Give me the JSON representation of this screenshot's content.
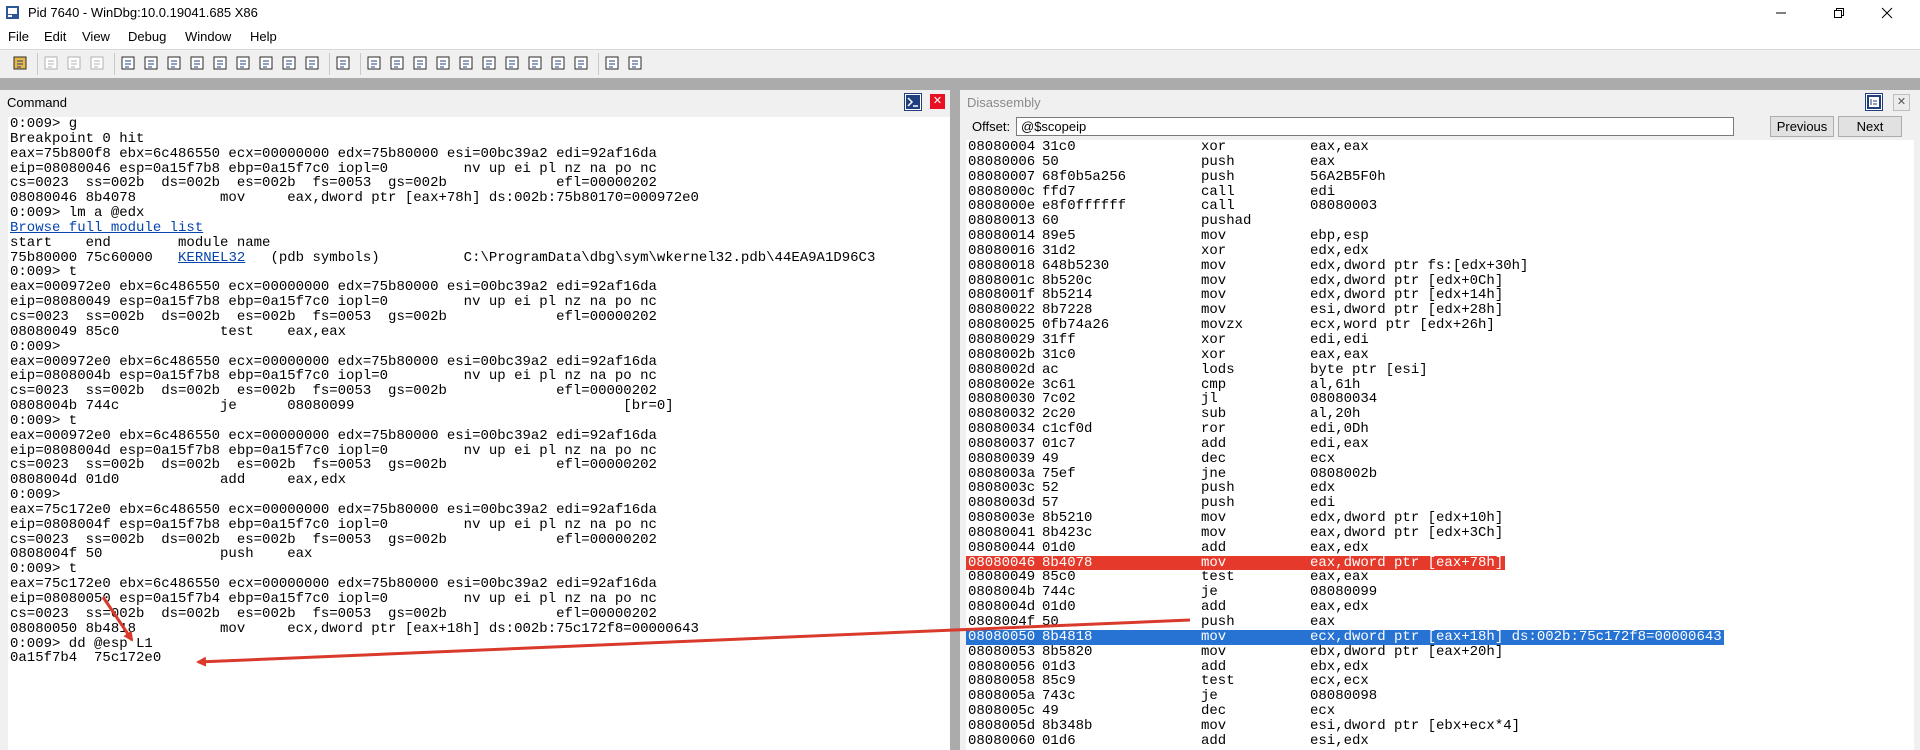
{
  "window": {
    "title": "Pid 7640 - WinDbg:10.0.19041.685 X86"
  },
  "menu": [
    "File",
    "Edit",
    "View",
    "Debug",
    "Window",
    "Help"
  ],
  "toolbar_icons": [
    "open-icon",
    "cut-icon",
    "copy-icon",
    "paste-icon",
    "go-icon",
    "restart-icon",
    "stop-debugging-icon",
    "break-icon",
    "step-into-icon",
    "step-over-icon",
    "step-out-icon",
    "run-to-cursor-icon",
    "source-mode-icon",
    "command-window-icon",
    "watch-window-icon",
    "locals-window-icon",
    "registers-window-icon",
    "memory-window-icon",
    "call-stack-icon",
    "disassembly-window-icon",
    "scratch-pad-icon",
    "processes-threads-icon",
    "source-mode-toggle-icon",
    "hex-mode-icon",
    "font-icon",
    "options-icon"
  ],
  "command": {
    "title": "Command",
    "lines": [
      "0:009> g",
      "Breakpoint 0 hit",
      "eax=75b800f8 ebx=6c486550 ecx=00000000 edx=75b80000 esi=00bc39a2 edi=92af16da",
      "eip=08080046 esp=0a15f7b8 ebp=0a15f7c0 iopl=0         nv up ei pl nz na po nc",
      "cs=0023  ss=002b  ds=002b  es=002b  fs=0053  gs=002b             efl=00000202",
      "08080046 8b4078          mov     eax,dword ptr [eax+78h] ds:002b:75b80170=000972e0",
      "0:009> lm a @edx",
      "Browse full module list",
      "start    end        module name",
      "75b80000 75c60000   KERNEL32   (pdb symbols)          C:\\ProgramData\\dbg\\sym\\wkernel32.pdb\\44EA9A1D96C3",
      "0:009> t",
      "eax=000972e0 ebx=6c486550 ecx=00000000 edx=75b80000 esi=00bc39a2 edi=92af16da",
      "eip=08080049 esp=0a15f7b8 ebp=0a15f7c0 iopl=0         nv up ei pl nz na po nc",
      "cs=0023  ss=002b  ds=002b  es=002b  fs=0053  gs=002b             efl=00000202",
      "08080049 85c0            test    eax,eax",
      "0:009>",
      "eax=000972e0 ebx=6c486550 ecx=00000000 edx=75b80000 esi=00bc39a2 edi=92af16da",
      "eip=0808004b esp=0a15f7b8 ebp=0a15f7c0 iopl=0         nv up ei pl nz na po nc",
      "cs=0023  ss=002b  ds=002b  es=002b  fs=0053  gs=002b             efl=00000202",
      "0808004b 744c            je      08080099                                [br=0]",
      "0:009> t",
      "eax=000972e0 ebx=6c486550 ecx=00000000 edx=75b80000 esi=00bc39a2 edi=92af16da",
      "eip=0808004d esp=0a15f7b8 ebp=0a15f7c0 iopl=0         nv up ei pl nz na po nc",
      "cs=0023  ss=002b  ds=002b  es=002b  fs=0053  gs=002b             efl=00000202",
      "0808004d 01d0            add     eax,edx",
      "0:009>",
      "eax=75c172e0 ebx=6c486550 ecx=00000000 edx=75b80000 esi=00bc39a2 edi=92af16da",
      "eip=0808004f esp=0a15f7b8 ebp=0a15f7c0 iopl=0         nv up ei pl nz na po nc",
      "cs=0023  ss=002b  ds=002b  es=002b  fs=0053  gs=002b             efl=00000202",
      "0808004f 50              push    eax",
      "0:009> t",
      "eax=75c172e0 ebx=6c486550 ecx=00000000 edx=75b80000 esi=00bc39a2 edi=92af16da",
      "eip=08080050 esp=0a15f7b4 ebp=0a15f7c0 iopl=0         nv up ei pl nz na po nc",
      "cs=0023  ss=002b  ds=002b  es=002b  fs=0053  gs=002b             efl=00000202",
      "08080050 8b4818          mov     ecx,dword ptr [eax+18h] ds:002b:75c172f8=00000643",
      "0:009> dd @esp L1",
      "0a15f7b4  75c172e0"
    ],
    "link_line": 7,
    "module_link_text": "KERNEL32"
  },
  "disassembly": {
    "title": "Disassembly",
    "offset_label": "Offset:",
    "offset_value": "@$scopeip",
    "previous_label": "Previous",
    "next_label": "Next",
    "rows": [
      {
        "addr": "08080004",
        "bytes": "31c0",
        "mnem": "xor",
        "ops": "eax,eax"
      },
      {
        "addr": "08080006",
        "bytes": "50",
        "mnem": "push",
        "ops": "eax"
      },
      {
        "addr": "08080007",
        "bytes": "68f0b5a256",
        "mnem": "push",
        "ops": "56A2B5F0h"
      },
      {
        "addr": "0808000c",
        "bytes": "ffd7",
        "mnem": "call",
        "ops": "edi"
      },
      {
        "addr": "0808000e",
        "bytes": "e8f0ffffff",
        "mnem": "call",
        "ops": "08080003"
      },
      {
        "addr": "08080013",
        "bytes": "60",
        "mnem": "pushad",
        "ops": ""
      },
      {
        "addr": "08080014",
        "bytes": "89e5",
        "mnem": "mov",
        "ops": "ebp,esp"
      },
      {
        "addr": "08080016",
        "bytes": "31d2",
        "mnem": "xor",
        "ops": "edx,edx"
      },
      {
        "addr": "08080018",
        "bytes": "648b5230",
        "mnem": "mov",
        "ops": "edx,dword ptr fs:[edx+30h]"
      },
      {
        "addr": "0808001c",
        "bytes": "8b520c",
        "mnem": "mov",
        "ops": "edx,dword ptr [edx+0Ch]"
      },
      {
        "addr": "0808001f",
        "bytes": "8b5214",
        "mnem": "mov",
        "ops": "edx,dword ptr [edx+14h]"
      },
      {
        "addr": "08080022",
        "bytes": "8b7228",
        "mnem": "mov",
        "ops": "esi,dword ptr [edx+28h]"
      },
      {
        "addr": "08080025",
        "bytes": "0fb74a26",
        "mnem": "movzx",
        "ops": "ecx,word ptr [edx+26h]"
      },
      {
        "addr": "08080029",
        "bytes": "31ff",
        "mnem": "xor",
        "ops": "edi,edi"
      },
      {
        "addr": "0808002b",
        "bytes": "31c0",
        "mnem": "xor",
        "ops": "eax,eax"
      },
      {
        "addr": "0808002d",
        "bytes": "ac",
        "mnem": "lods",
        "ops": "byte ptr [esi]"
      },
      {
        "addr": "0808002e",
        "bytes": "3c61",
        "mnem": "cmp",
        "ops": "al,61h"
      },
      {
        "addr": "08080030",
        "bytes": "7c02",
        "mnem": "jl",
        "ops": "08080034"
      },
      {
        "addr": "08080032",
        "bytes": "2c20",
        "mnem": "sub",
        "ops": "al,20h"
      },
      {
        "addr": "08080034",
        "bytes": "c1cf0d",
        "mnem": "ror",
        "ops": "edi,0Dh"
      },
      {
        "addr": "08080037",
        "bytes": "01c7",
        "mnem": "add",
        "ops": "edi,eax"
      },
      {
        "addr": "08080039",
        "bytes": "49",
        "mnem": "dec",
        "ops": "ecx"
      },
      {
        "addr": "0808003a",
        "bytes": "75ef",
        "mnem": "jne",
        "ops": "0808002b"
      },
      {
        "addr": "0808003c",
        "bytes": "52",
        "mnem": "push",
        "ops": "edx"
      },
      {
        "addr": "0808003d",
        "bytes": "57",
        "mnem": "push",
        "ops": "edi"
      },
      {
        "addr": "0808003e",
        "bytes": "8b5210",
        "mnem": "mov",
        "ops": "edx,dword ptr [edx+10h]"
      },
      {
        "addr": "08080041",
        "bytes": "8b423c",
        "mnem": "mov",
        "ops": "eax,dword ptr [edx+3Ch]"
      },
      {
        "addr": "08080044",
        "bytes": "01d0",
        "mnem": "add",
        "ops": "eax,edx"
      },
      {
        "addr": "08080046",
        "bytes": "8b4078",
        "mnem": "mov",
        "ops": "eax,dword ptr [eax+78h]",
        "highlight": "red"
      },
      {
        "addr": "08080049",
        "bytes": "85c0",
        "mnem": "test",
        "ops": "eax,eax"
      },
      {
        "addr": "0808004b",
        "bytes": "744c",
        "mnem": "je",
        "ops": "08080099"
      },
      {
        "addr": "0808004d",
        "bytes": "01d0",
        "mnem": "add",
        "ops": "eax,edx"
      },
      {
        "addr": "0808004f",
        "bytes": "50",
        "mnem": "push",
        "ops": "eax"
      },
      {
        "addr": "08080050",
        "bytes": "8b4818",
        "mnem": "mov",
        "ops": "ecx,dword ptr [eax+18h] ds:002b:75c172f8=00000643",
        "highlight": "blue"
      },
      {
        "addr": "08080053",
        "bytes": "8b5820",
        "mnem": "mov",
        "ops": "ebx,dword ptr [eax+20h]"
      },
      {
        "addr": "08080056",
        "bytes": "01d3",
        "mnem": "add",
        "ops": "ebx,edx"
      },
      {
        "addr": "08080058",
        "bytes": "85c9",
        "mnem": "test",
        "ops": "ecx,ecx"
      },
      {
        "addr": "0808005a",
        "bytes": "743c",
        "mnem": "je",
        "ops": "08080098"
      },
      {
        "addr": "0808005c",
        "bytes": "49",
        "mnem": "dec",
        "ops": "ecx"
      },
      {
        "addr": "0808005d",
        "bytes": "8b348b",
        "mnem": "mov",
        "ops": "esi,dword ptr [ebx+ecx*4]"
      },
      {
        "addr": "08080060",
        "bytes": "01d6",
        "mnem": "add",
        "ops": "esi,edx"
      }
    ]
  },
  "colors": {
    "highlight_red": "#e53a2b",
    "highlight_blue": "#2773d3",
    "annotation_arrow": "#d93a2b",
    "link": "#0645ad"
  }
}
